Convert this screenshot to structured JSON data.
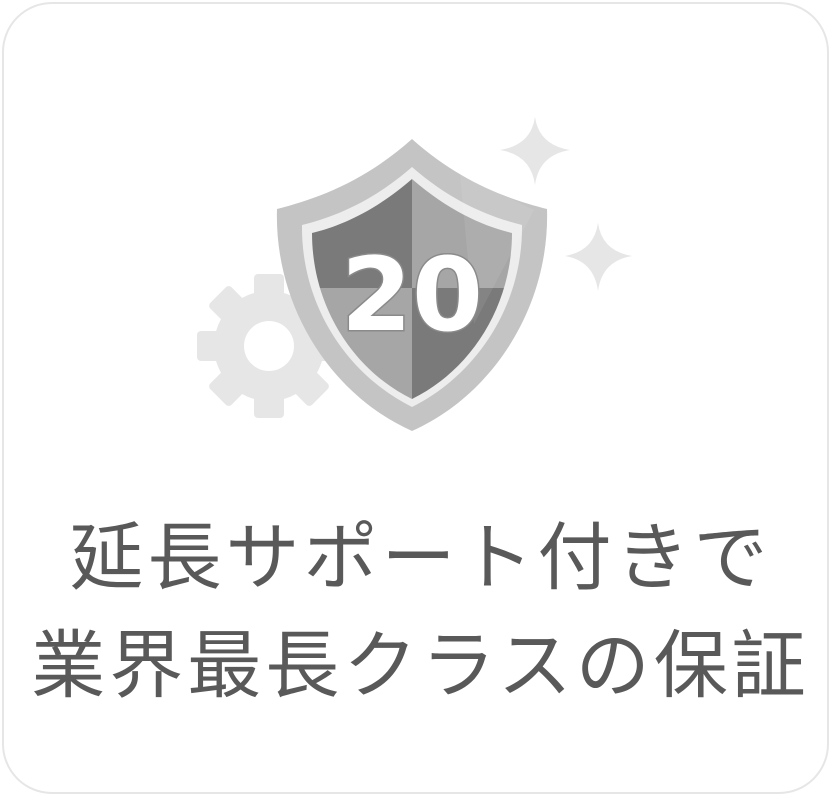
{
  "badge": {
    "number": "20",
    "icons": [
      "shield-icon",
      "gear-icon",
      "sparkle-icon"
    ]
  },
  "caption": {
    "line1": "延長サポート付きで",
    "line2": "業界最長クラスの保証"
  },
  "colors": {
    "border": "#e6e6e6",
    "text": "#595959",
    "shield_dark": "#7a7a7a",
    "shield_light": "#a6a6a6",
    "shield_rim": "#c4c4c4",
    "decor": "#e6e6e6"
  }
}
